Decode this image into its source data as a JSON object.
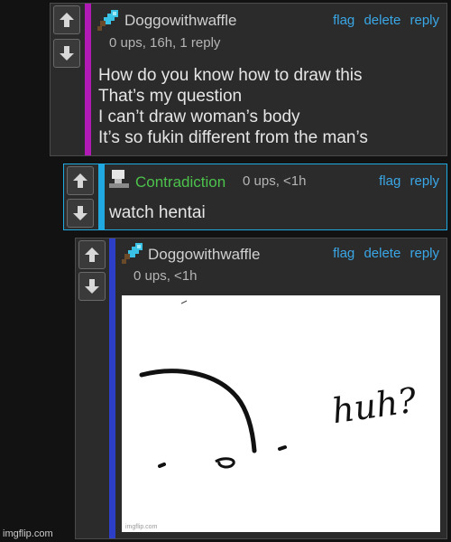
{
  "comments": [
    {
      "username": "Doggowithwaffle",
      "meta": "0 ups, 16h, 1 reply",
      "actions": [
        "flag",
        "delete",
        "reply"
      ],
      "body": "How do you know how to draw this\nThat’s my question\nI can’t draw woman’s body\nIt’s so fukin different from the man’s",
      "bar_color": "#b21ab5",
      "username_color": "#d0d0d0",
      "avatar_icon": "diamond-sword-icon"
    },
    {
      "username": "Contradiction",
      "meta": "0 ups, <1h",
      "actions": [
        "flag",
        "reply"
      ],
      "body": "watch hentai",
      "bar_color": "#20a8e0",
      "username_color": "#4cc24c",
      "avatar_icon": "anvil-icon"
    },
    {
      "username": "Doggowithwaffle",
      "meta": "0 ups, <1h",
      "actions": [
        "flag",
        "delete",
        "reply"
      ],
      "bar_color": "#2d3ec8",
      "username_color": "#d0d0d0",
      "avatar_icon": "diamond-sword-icon",
      "image_text": "huh?",
      "image_credit": "imgflip.com"
    }
  ],
  "watermark": "imgflip.com"
}
